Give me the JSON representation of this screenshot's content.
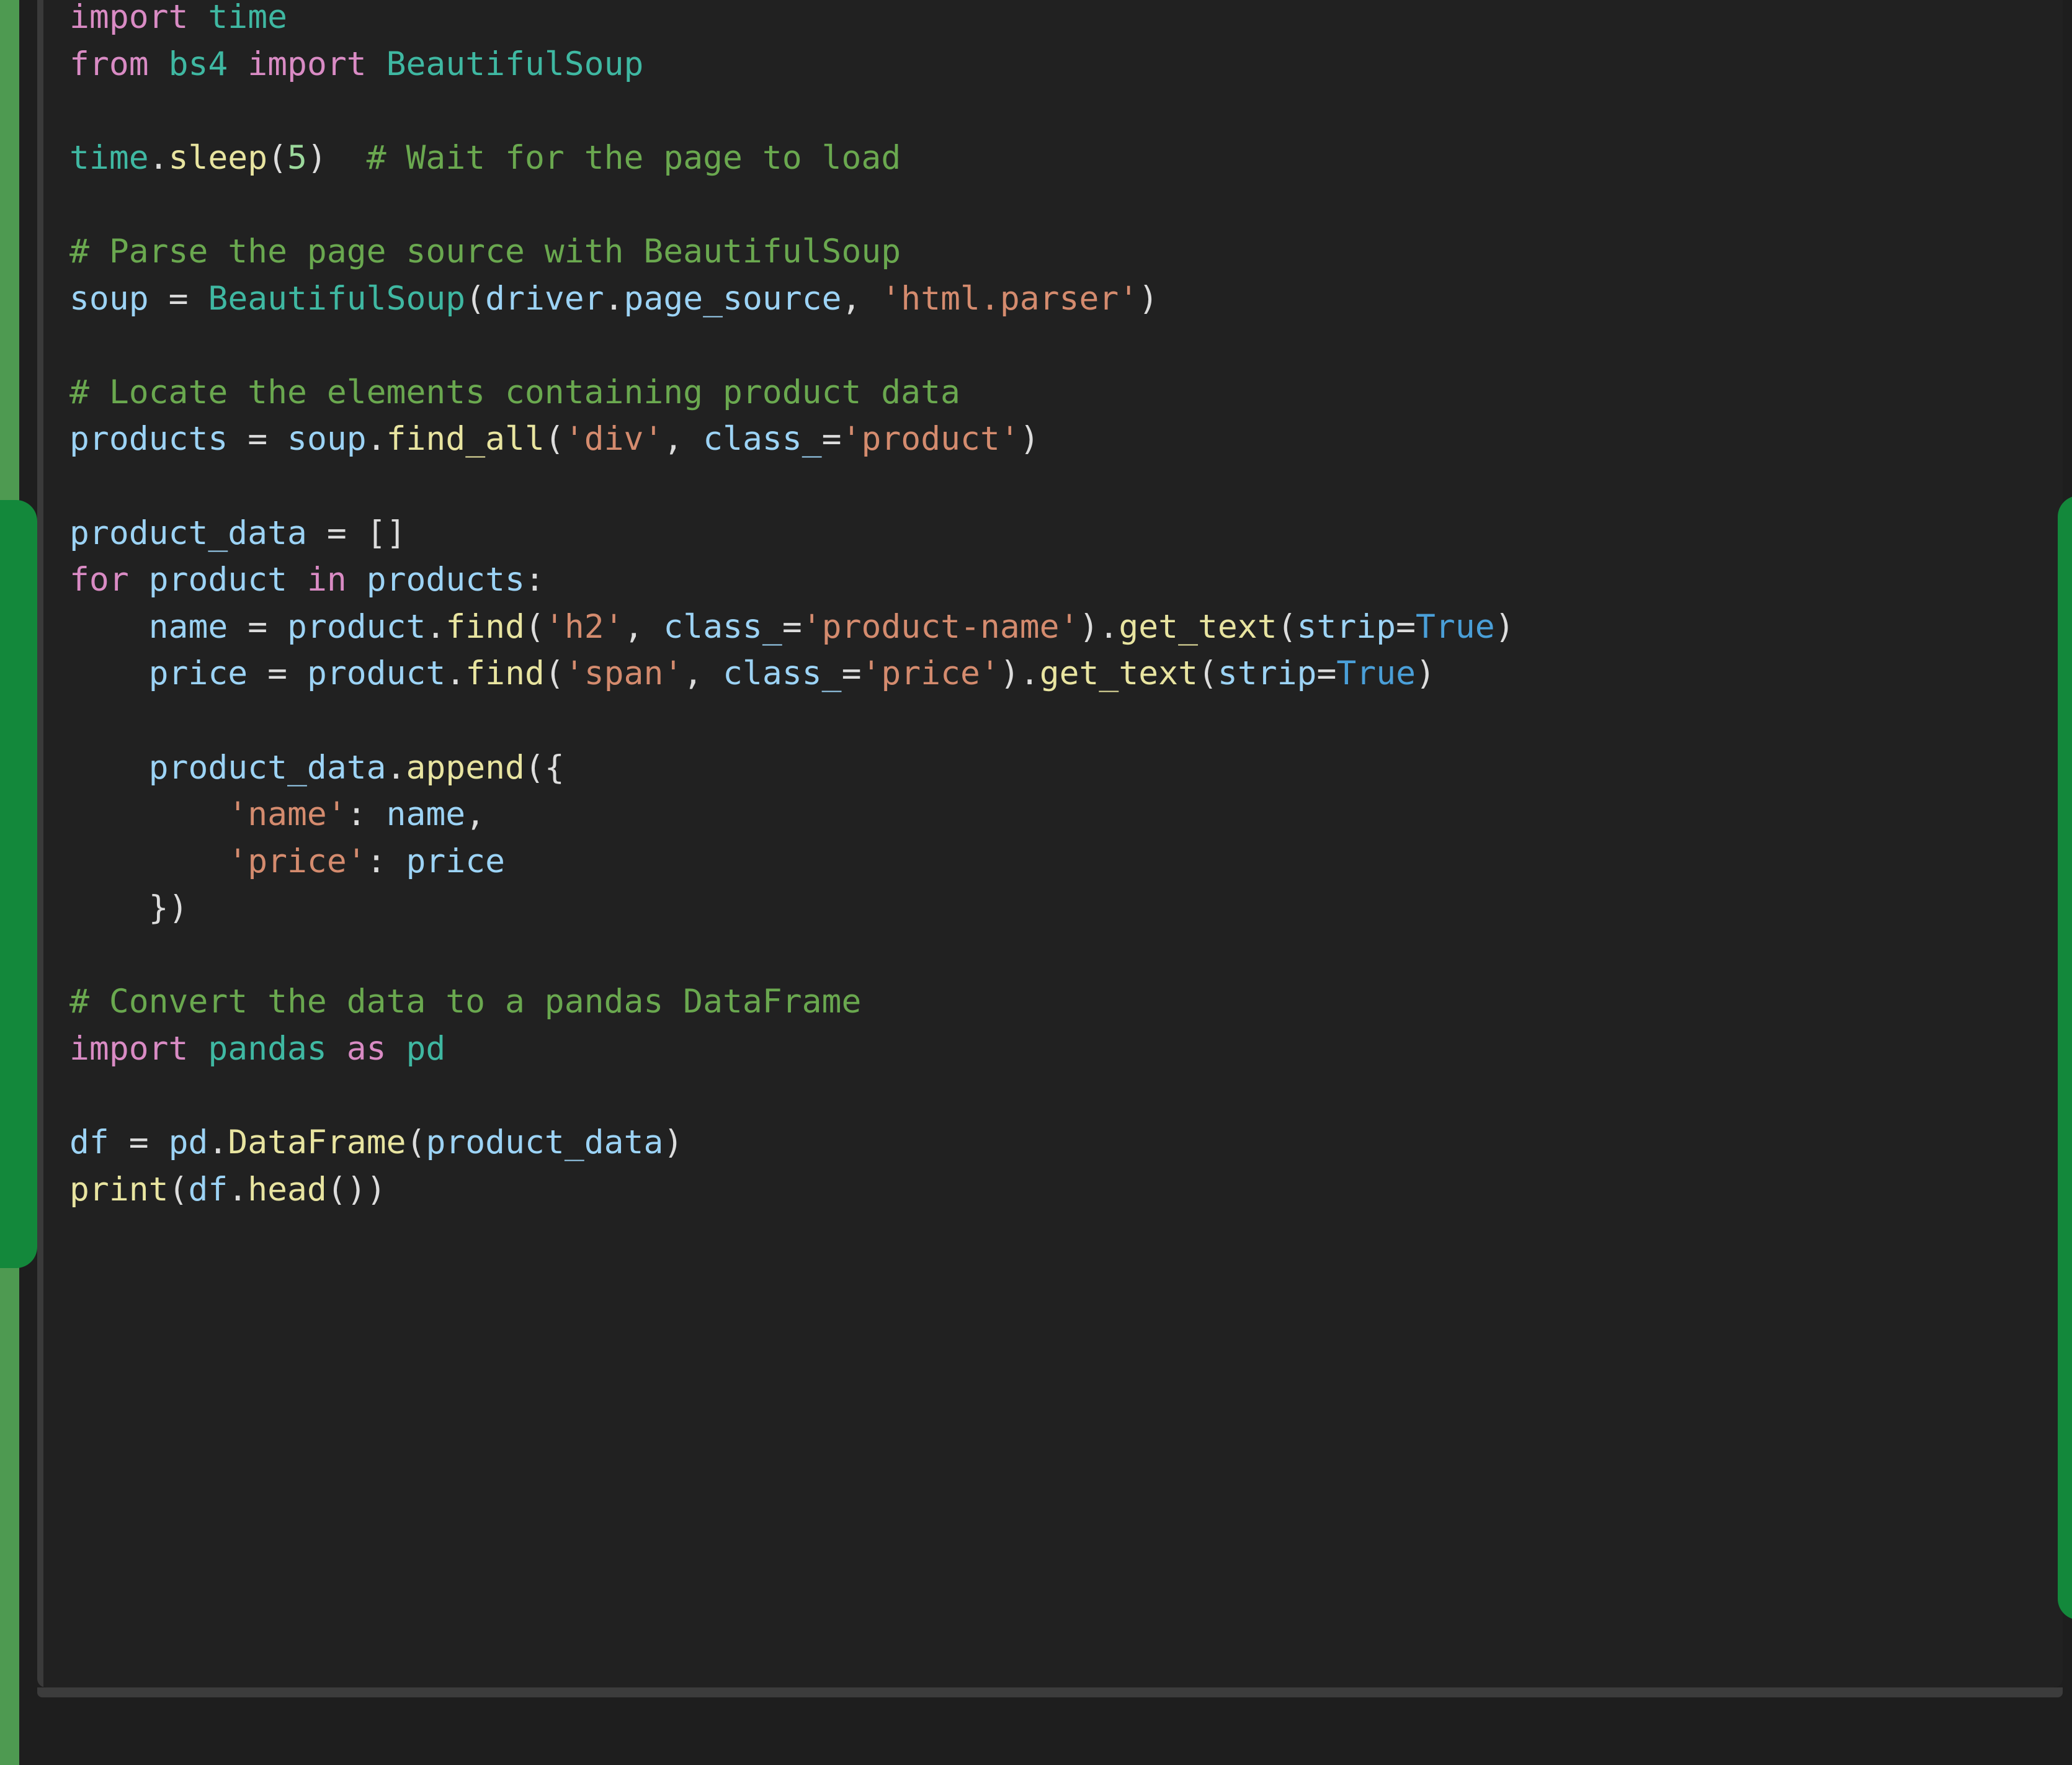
{
  "theme": {
    "background": "#1e1e1e",
    "code_background": "#212121",
    "left_rail_color": "#4e9a51",
    "scrollbar_thumb_color": "#13883b",
    "gutter_line_color": "#3a3a3a",
    "scroll_track_color": "#3c3c3c",
    "token_colors": {
      "keyword": "#d98bc4",
      "module": "#3fb8a2",
      "function": "#e8e4a0",
      "variable": "#9cd3f5",
      "string": "#d48b6e",
      "number": "#9cd99c",
      "comment": "#6aa84f",
      "operator": "#dcdcdc",
      "boolean": "#4a9fd8"
    }
  },
  "code": {
    "language": "python",
    "lines": [
      "import time",
      "from bs4 import BeautifulSoup",
      "",
      "time.sleep(5)  # Wait for the page to load",
      "",
      "# Parse the page source with BeautifulSoup",
      "soup = BeautifulSoup(driver.page_source, 'html.parser')",
      "",
      "# Locate the elements containing product data",
      "products = soup.find_all('div', class_='product')",
      "",
      "product_data = []",
      "for product in products:",
      "    name = product.find('h2', class_='product-name').get_text(strip=True)",
      "    price = product.find('span', class_='price').get_text(strip=True)",
      "",
      "    product_data.append({",
      "        'name': name,",
      "        'price': price",
      "    })",
      "",
      "# Convert the data to a pandas DataFrame",
      "import pandas as pd",
      "",
      "df = pd.DataFrame(product_data)",
      "print(df.head())"
    ],
    "comments": [
      "# Wait for the page to load",
      "# Parse the page source with BeautifulSoup",
      "# Locate the elements containing product data",
      "# Convert the data to a pandas DataFrame"
    ],
    "imports": [
      "time",
      "bs4.BeautifulSoup",
      "pandas as pd"
    ],
    "string_literals": [
      "html.parser",
      "div",
      "product",
      "h2",
      "product-name",
      "span",
      "price",
      "name",
      "price"
    ],
    "numbers": [
      "5"
    ],
    "booleans": [
      "True"
    ],
    "variables": [
      "soup",
      "driver",
      "page_source",
      "products",
      "product",
      "product_data",
      "name",
      "price",
      "df",
      "pd"
    ],
    "functions": [
      "sleep",
      "find_all",
      "find",
      "get_text",
      "append",
      "DataFrame",
      "print",
      "head"
    ]
  },
  "scrollbars": {
    "vertical_left_label": "vertical-scrollbar-thumb-left",
    "vertical_right_label": "vertical-scrollbar-thumb-right",
    "horizontal_label": "horizontal-scrollbar-track"
  }
}
